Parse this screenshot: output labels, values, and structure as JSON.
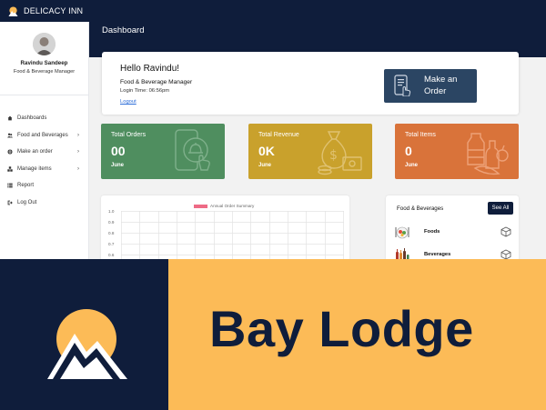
{
  "app": {
    "title": "DELICACY INN"
  },
  "profile": {
    "name": "Ravindu Sandeep",
    "role": "Food & Beverage Manager"
  },
  "sidebar": {
    "items": [
      {
        "label": "Dashboards",
        "icon": "home-icon",
        "has_chevron": false
      },
      {
        "label": "Food and Beverages",
        "icon": "users-icon",
        "has_chevron": true
      },
      {
        "label": "Make an order",
        "icon": "globe-icon",
        "has_chevron": true
      },
      {
        "label": "Manage items",
        "icon": "cubes-icon",
        "has_chevron": true
      },
      {
        "label": "Report",
        "icon": "list-icon",
        "has_chevron": false
      },
      {
        "label": "Log Out",
        "icon": "logout-icon",
        "has_chevron": false
      }
    ]
  },
  "header": {
    "title": "Dashboard"
  },
  "welcome": {
    "greeting": "Hello Ravindu!",
    "role": "Food & Beverage Manager",
    "login_time": "Login Time: 06:56pm",
    "logout_link": "Logout"
  },
  "order_button": {
    "label": "Make an Order"
  },
  "cards": [
    {
      "title": "Total Orders",
      "value": "00",
      "period": "June",
      "color": "#4f8e5f",
      "icon": "phone-food-order-icon"
    },
    {
      "title": "Total Revenue",
      "value": "0K",
      "period": "June",
      "color": "#c9a12c",
      "icon": "money-bag-icon"
    },
    {
      "title": "Total Items",
      "value": "0",
      "period": "June",
      "color": "#d9733a",
      "icon": "grocery-items-icon"
    }
  ],
  "chart_data": {
    "type": "bar",
    "title": "",
    "series": [
      {
        "name": "Annual Order Summary",
        "values": []
      }
    ],
    "categories": [],
    "y_ticks": [
      "1.0",
      "0.9",
      "0.8",
      "0.7",
      "0.6"
    ],
    "ylim": [
      0,
      1
    ],
    "grid": true,
    "legend": "top"
  },
  "food_beverages": {
    "title": "Food & Beverages",
    "see_all": "See All",
    "rows": [
      {
        "label": "Foods",
        "icon": "food-plate-icon"
      },
      {
        "label": "Beverages",
        "icon": "bottles-icon"
      }
    ]
  },
  "banner": {
    "brand_name": "Bay Lodge",
    "colors": {
      "navy": "#0f1d3b",
      "gold": "#fcbb57"
    }
  }
}
